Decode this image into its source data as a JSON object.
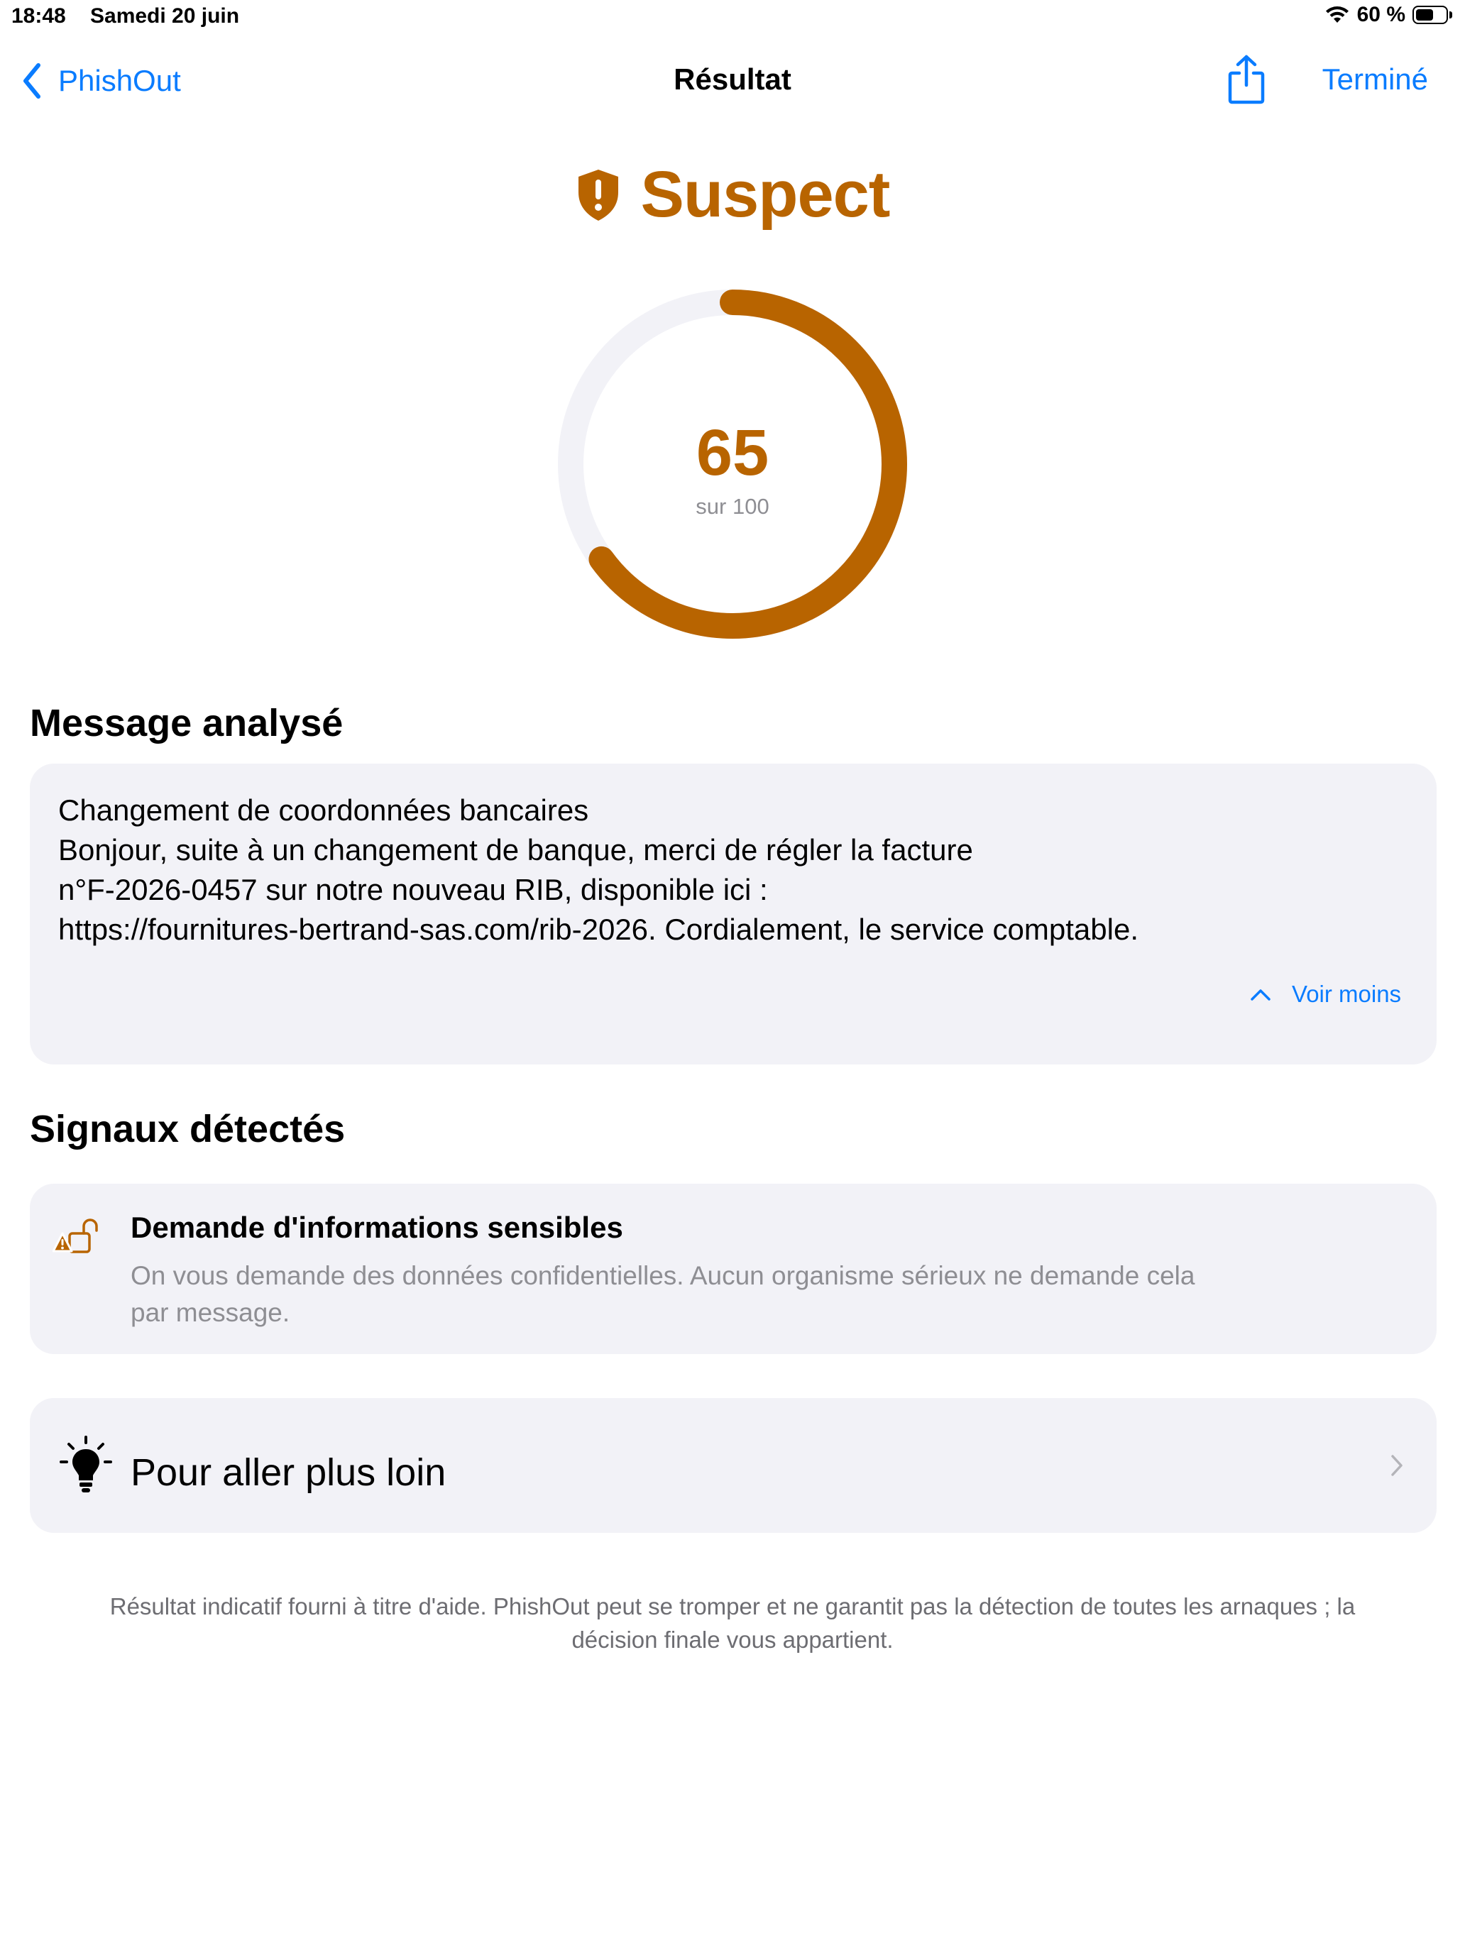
{
  "status_bar": {
    "time": "18:48",
    "date": "Samedi 20 juin",
    "battery_text": "60 %",
    "battery_level": 0.6
  },
  "nav": {
    "back_label": "PhishOut",
    "title": "Résultat",
    "share_icon": "share-icon",
    "done_label": "Terminé"
  },
  "verdict": {
    "icon": "shield-exclamation-icon",
    "label": "Suspect",
    "color": "#b86400"
  },
  "score": {
    "value": 65,
    "value_text": "65",
    "max_text": "sur 100",
    "gauge_fraction": 0.65,
    "arc_color": "#b86400",
    "track_color": "#f2f2f7"
  },
  "message": {
    "header": "Message analysé",
    "lines": [
      "Changement de coordonnées bancaires",
      "Bonjour, suite à un changement de banque, merci de régler la facture",
      "n°F-2026-0457 sur notre nouveau RIB, disponible ici :",
      "https://fournitures-bertrand-sas.com/rib-2026. Cordialement, le service comptable."
    ],
    "toggle_label": "Voir moins",
    "toggle_icon": "chevron-up-icon"
  },
  "signals": {
    "header": "Signaux détectés",
    "items": [
      {
        "icon": "lock-open-warning-icon",
        "title": "Demande d'informations sensibles",
        "description_lines": [
          "On vous demande des données confidentielles. Aucun organisme sérieux ne demande cela",
          "par message."
        ]
      }
    ]
  },
  "learn_more": {
    "icon": "lightbulb-icon",
    "label": "Pour aller plus loin",
    "chevron_icon": "chevron-right-icon"
  },
  "disclaimer_lines": [
    "Résultat indicatif fourni à titre d'aide. PhishOut peut se tromper et ne garantit pas la détection de toutes les arnaques ; la",
    "décision finale vous appartient."
  ],
  "colors": {
    "accent_blue": "#0a7cff",
    "warning_orange": "#b86400",
    "card_background": "#f2f2f7",
    "secondary_text": "#8e8e93"
  }
}
